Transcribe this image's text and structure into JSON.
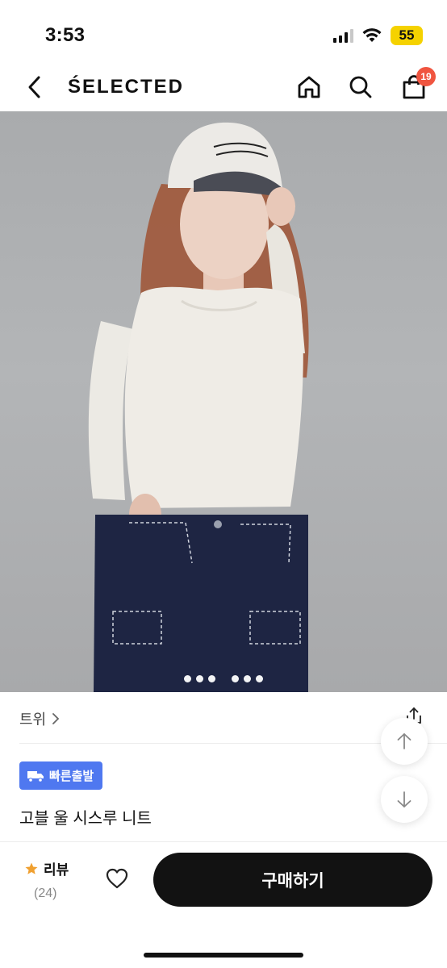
{
  "status_bar": {
    "time": "3:53",
    "battery": "55"
  },
  "nav": {
    "brand": "ŚELECTED",
    "cart_count": "19"
  },
  "carousel": {
    "dot_count": 6
  },
  "product": {
    "breadcrumb": "트위",
    "badge_label": "빠른출발",
    "name": "고블 울 시스루 니트"
  },
  "bottom_bar": {
    "review_label": "리뷰",
    "review_count": "(24)",
    "buy_label": "구매하기"
  },
  "colors": {
    "accent_badge": "#4f78f0",
    "cart_badge": "#f05540",
    "star": "#f0a030",
    "buy_button": "#121212"
  },
  "icons": [
    "back-icon",
    "home-icon",
    "search-icon",
    "cart-icon",
    "chevron-right-icon",
    "share-icon",
    "arrow-up-icon",
    "arrow-down-icon",
    "truck-icon",
    "star-icon",
    "heart-icon"
  ]
}
